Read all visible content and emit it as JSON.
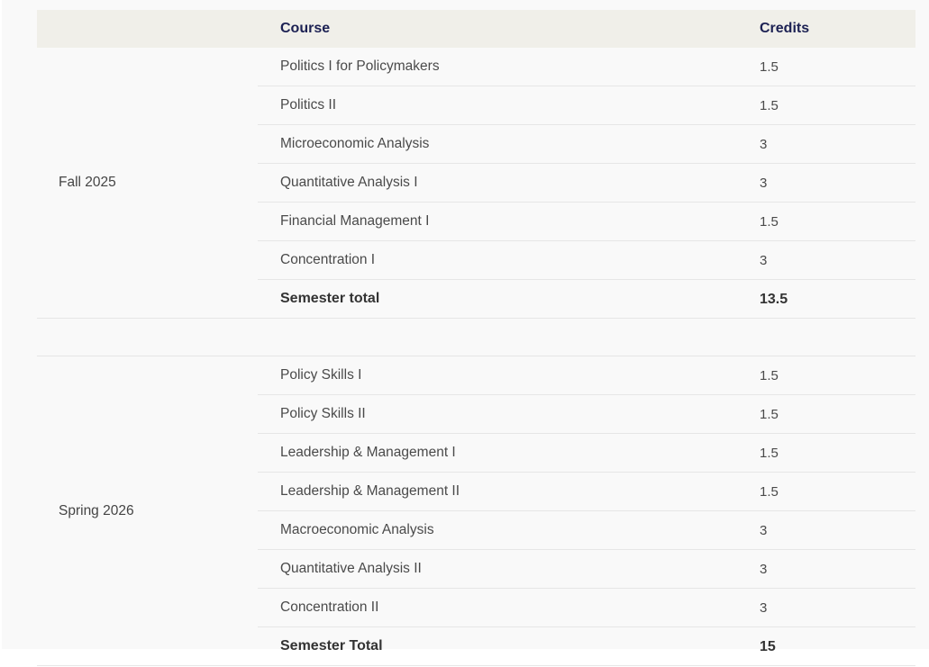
{
  "table": {
    "headers": {
      "semester": "",
      "course": "Course",
      "credits": "Credits"
    },
    "groups": [
      {
        "semester": "Fall 2025",
        "rows": [
          {
            "course": "Politics I for Policymakers",
            "credits": "1.5"
          },
          {
            "course": "Politics II",
            "credits": "1.5"
          },
          {
            "course": "Microeconomic Analysis",
            "credits": "3"
          },
          {
            "course": "Quantitative Analysis I",
            "credits": "3"
          },
          {
            "course": "Financial Management I",
            "credits": "1.5"
          },
          {
            "course": "Concentration I",
            "credits": "3"
          },
          {
            "course": "Semester total",
            "credits": "13.5",
            "total": true
          }
        ]
      },
      {
        "semester": "Spring 2026",
        "rows": [
          {
            "course": "Policy Skills I",
            "credits": "1.5"
          },
          {
            "course": "Policy Skills II",
            "credits": "1.5"
          },
          {
            "course": "Leadership & Management I",
            "credits": "1.5"
          },
          {
            "course": "Leadership & Management II",
            "credits": "1.5"
          },
          {
            "course": "Macroeconomic Analysis",
            "credits": "3"
          },
          {
            "course": "Quantitative Analysis II",
            "credits": "3"
          },
          {
            "course": "Concentration II",
            "credits": "3"
          },
          {
            "course": "Semester Total",
            "credits": "15",
            "total": true
          }
        ]
      }
    ]
  },
  "colors": {
    "header_bg": "#f0efe9",
    "header_text": "#1c2153",
    "body_text": "#4a4a4a",
    "row_border": "#e6e6e6",
    "page_bg": "#f9f9f9"
  }
}
